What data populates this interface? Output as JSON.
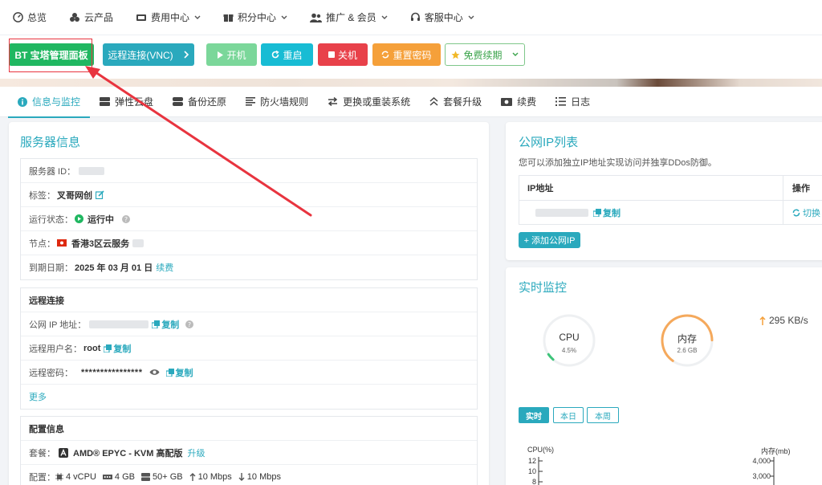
{
  "nav": {
    "items": [
      {
        "label": "总览",
        "icon": "dashboard-icon",
        "dropdown": false
      },
      {
        "label": "云产品",
        "icon": "cloud-products-icon",
        "dropdown": false
      },
      {
        "label": "费用中心",
        "icon": "billing-icon",
        "dropdown": true
      },
      {
        "label": "积分中心",
        "icon": "gift-icon",
        "dropdown": true
      },
      {
        "label": "推广 & 会员",
        "icon": "users-icon",
        "dropdown": true
      },
      {
        "label": "客服中心",
        "icon": "headset-icon",
        "dropdown": true
      }
    ]
  },
  "actions": {
    "bt_panel": "BT 宝塔管理面板",
    "vnc": "远程连接(VNC)",
    "power_on": "开机",
    "restart": "重启",
    "shutdown": "关机",
    "reset_password": "重置密码",
    "free_renew": "免费续期"
  },
  "tabs": [
    {
      "label": "信息与监控",
      "icon": "info-icon",
      "active": true
    },
    {
      "label": "弹性云盘",
      "icon": "disk-icon",
      "active": false
    },
    {
      "label": "备份还原",
      "icon": "backup-icon",
      "active": false
    },
    {
      "label": "防火墙规则",
      "icon": "firewall-icon",
      "active": false
    },
    {
      "label": "更换或重装系统",
      "icon": "swap-icon",
      "active": false
    },
    {
      "label": "套餐升级",
      "icon": "upgrade-icon",
      "active": false
    },
    {
      "label": "续费",
      "icon": "renew-icon",
      "active": false
    },
    {
      "label": "日志",
      "icon": "log-icon",
      "active": false
    }
  ],
  "server": {
    "title": "服务器信息",
    "id_label": "服务器 ID：",
    "tag_label": "标签：",
    "tag_value": "叉哥网创",
    "status_label": "运行状态：",
    "status_value": "运行中",
    "node_label": "节点：",
    "node_value": "香港3区云服务",
    "expire_label": "到期日期：",
    "expire_value": "2025 年 03 月 01 日",
    "renew_link": "续费"
  },
  "remote": {
    "title": "远程连接",
    "ip_label": "公网 IP 地址：",
    "copy": "复制",
    "user_label": "远程用户名：",
    "user_value": "root",
    "pass_label": "远程密码：",
    "pass_value": "****************",
    "more": "更多"
  },
  "config": {
    "title": "配置信息",
    "plan_label": "套餐：",
    "plan_value": "AMD® EPYC - KVM 高配版",
    "upgrade": "升级",
    "spec_label": "配置：",
    "vcpu": "4 vCPU",
    "ram": "4 GB",
    "disk": "50+ GB",
    "up": "10 Mbps",
    "down": "10 Mbps"
  },
  "ip_list": {
    "title": "公网IP列表",
    "desc": "您可以添加独立IP地址实现访问并独享DDos防御。",
    "col_ip": "IP地址",
    "col_op": "操作",
    "copy": "复制",
    "switch": "切换",
    "add": "+ 添加公网IP"
  },
  "monitor": {
    "title": "实时监控",
    "cpu_label": "CPU",
    "cpu_value": "4.5%",
    "cpu_fraction": 0.045,
    "mem_label": "内存",
    "mem_value": "2.6 GB",
    "mem_fraction": 0.65,
    "net_value": "295 KB/s",
    "range_now": "实时",
    "range_day": "本日",
    "range_week": "本周"
  },
  "chart_data": {
    "type": "line",
    "series": [
      {
        "name": "CPU(%)",
        "values": []
      },
      {
        "name": "内存(mb)",
        "values": []
      }
    ],
    "cpu_ticks": [
      "12",
      "10",
      "8"
    ],
    "mem_ticks": [
      "4,000",
      "3,000"
    ],
    "ylabel_left": "CPU(%)",
    "ylabel_right": "内存(mb)"
  },
  "colors": {
    "accent": "#2aa9bd",
    "bt_green": "#20b761",
    "danger": "#e8414a",
    "warning": "#f5a03a"
  }
}
